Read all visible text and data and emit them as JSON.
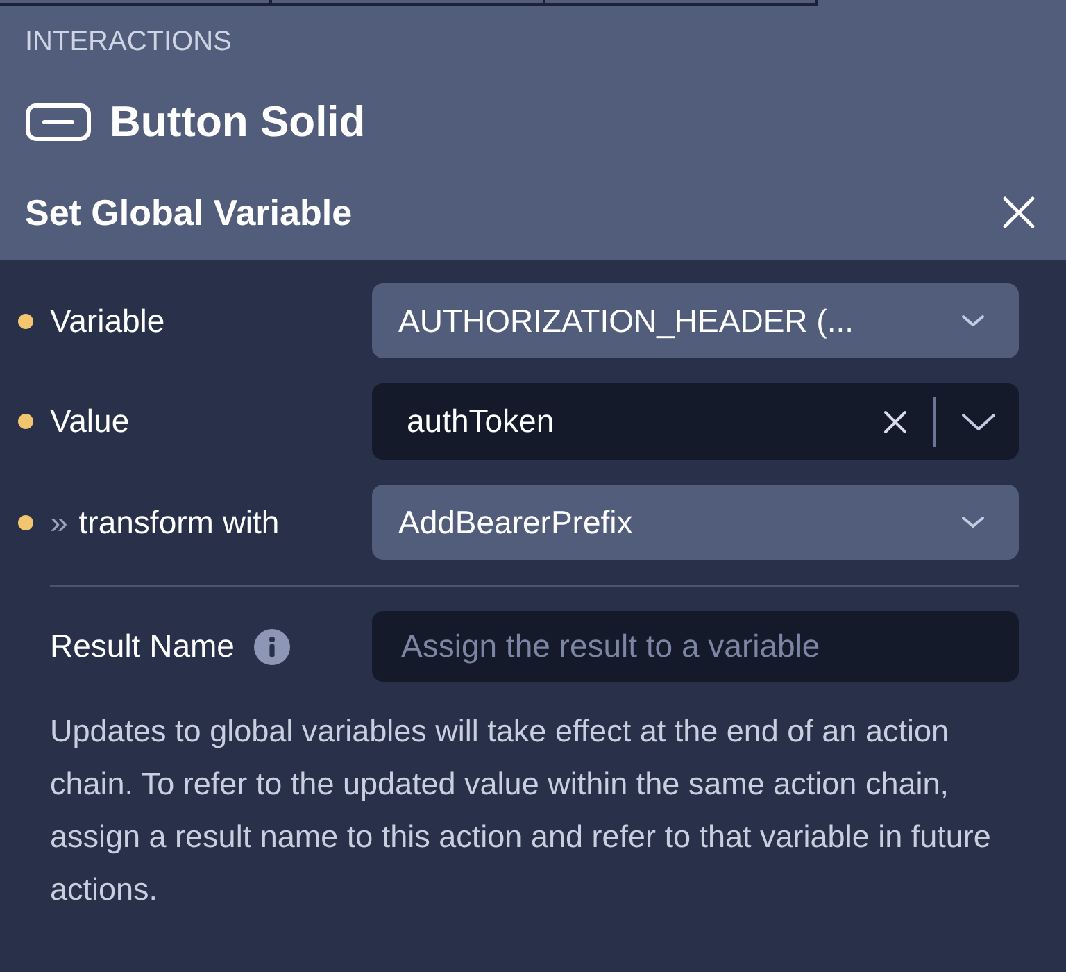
{
  "section_label": "INTERACTIONS",
  "component": {
    "title": "Button Solid"
  },
  "action": {
    "title": "Set Global Variable"
  },
  "fields": [
    {
      "kind": "select",
      "label": "Variable",
      "required": true,
      "value": "AUTHORIZATION_HEADER (..."
    },
    {
      "kind": "combo",
      "label": "Value",
      "required": true,
      "value": "authToken"
    },
    {
      "kind": "select",
      "label": "transform with",
      "prefix": "»",
      "required": true,
      "value": "AddBearerPrefix"
    }
  ],
  "result_name": {
    "label": "Result Name",
    "placeholder": "Assign the result to a variable"
  },
  "help_text": "Updates to global variables will take effect at the end of an action chain. To refer to the updated value within the same action chain, assign a result name to this action and refer to that variable in future actions."
}
